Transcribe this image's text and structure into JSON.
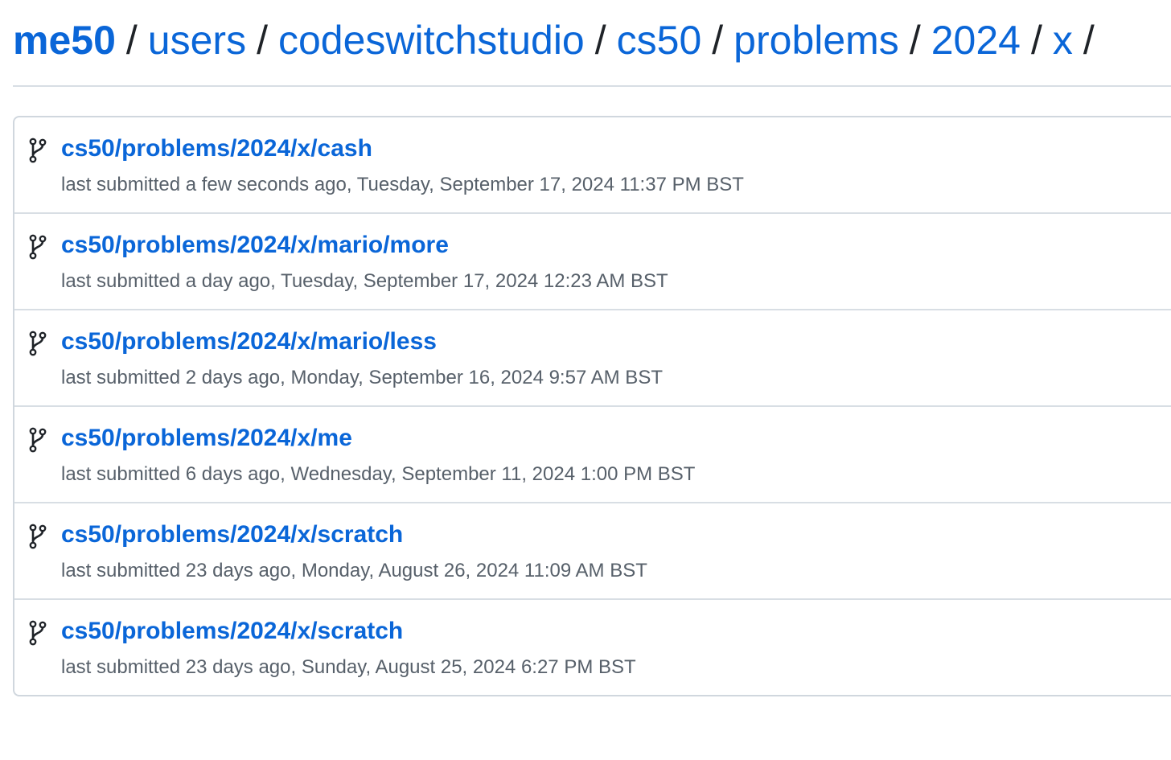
{
  "breadcrumb": {
    "items": [
      "me50",
      "users",
      "codeswitchstudio",
      "cs50",
      "problems",
      "2024",
      "x"
    ],
    "separator": "/"
  },
  "submissions": [
    {
      "title": "cs50/problems/2024/x/cash",
      "subtitle": "last submitted a few seconds ago, Tuesday, September 17, 2024 11:37 PM BST"
    },
    {
      "title": "cs50/problems/2024/x/mario/more",
      "subtitle": "last submitted a day ago, Tuesday, September 17, 2024 12:23 AM BST"
    },
    {
      "title": "cs50/problems/2024/x/mario/less",
      "subtitle": "last submitted 2 days ago, Monday, September 16, 2024 9:57 AM BST"
    },
    {
      "title": "cs50/problems/2024/x/me",
      "subtitle": "last submitted 6 days ago, Wednesday, September 11, 2024 1:00 PM BST"
    },
    {
      "title": "cs50/problems/2024/x/scratch",
      "subtitle": "last submitted 23 days ago, Monday, August 26, 2024 11:09 AM BST"
    },
    {
      "title": "cs50/problems/2024/x/scratch",
      "subtitle": "last submitted 23 days ago, Sunday, August 25, 2024 6:27 PM BST"
    }
  ],
  "icons": {
    "row": "git-branch-icon"
  },
  "colors": {
    "link": "#0a66d8",
    "text": "#1f2328",
    "muted": "#57606a",
    "border": "#d0d7de"
  }
}
